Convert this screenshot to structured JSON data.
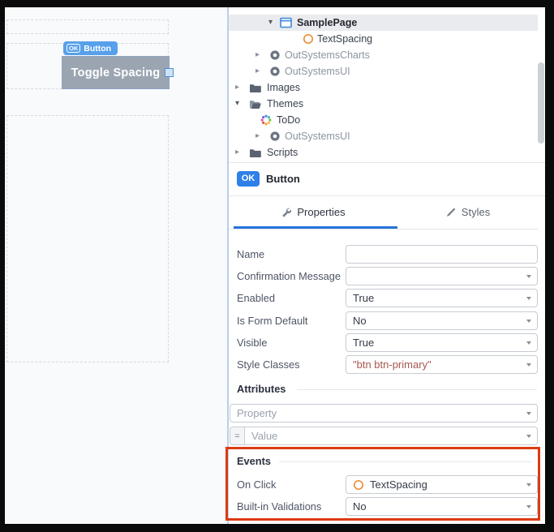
{
  "icons": {
    "chevron_down": "▾",
    "chevron_right": "▸"
  },
  "canvas": {
    "widget_badge": {
      "icon_label": "OK",
      "label": "Button"
    },
    "button_label": "Toggle Spacing"
  },
  "tree": {
    "items": [
      {
        "label": "SamplePage",
        "icon": "web-screen-icon",
        "state": "expanded",
        "selected": true
      },
      {
        "label": "TextSpacing",
        "icon": "screen-action-icon",
        "state": "leaf"
      },
      {
        "label": "OutSystemsCharts",
        "icon": "dependency-icon",
        "state": "collapsed",
        "muted": true
      },
      {
        "label": "OutSystemsUI",
        "icon": "dependency-icon",
        "state": "collapsed",
        "muted": true
      },
      {
        "label": "Images",
        "icon": "folder-icon",
        "state": "collapsed"
      },
      {
        "label": "Themes",
        "icon": "folder-open-icon",
        "state": "expanded"
      },
      {
        "label": "ToDo",
        "icon": "theme-icon",
        "state": "leaf"
      },
      {
        "label": "OutSystemsUI",
        "icon": "dependency-icon",
        "state": "collapsed",
        "muted": true
      },
      {
        "label": "Scripts",
        "icon": "folder-icon",
        "state": "collapsed"
      }
    ]
  },
  "inspector": {
    "header": {
      "badge": "OK",
      "title": "Button"
    },
    "tabs": [
      {
        "label": "Properties",
        "active": true
      },
      {
        "label": "Styles",
        "active": false
      }
    ],
    "fields": [
      {
        "label": "Name",
        "value": ""
      },
      {
        "label": "Confirmation Message",
        "value": ""
      },
      {
        "label": "Enabled",
        "value": "True"
      },
      {
        "label": "Is Form Default",
        "value": "No"
      },
      {
        "label": "Visible",
        "value": "True"
      },
      {
        "label": "Style Classes",
        "value": "\"btn btn-primary\""
      }
    ],
    "attributes": {
      "title": "Attributes",
      "property_placeholder": "Property",
      "equals_sign": "=",
      "value_placeholder": "Value"
    },
    "events": {
      "title": "Events",
      "on_click_label": "On Click",
      "on_click_value": "TextSpacing",
      "validations_label": "Built-in Validations",
      "validations_value": "No"
    }
  },
  "colors": {
    "accent_blue": "#2f7fe8",
    "tab_underline": "#2574db",
    "annotation_red": "#dc3a12",
    "expression_text": "#a85751",
    "selection_blue": "#4a90d9",
    "widget_gray": "#9ba5b2",
    "splitter_blue": "#bad0e8"
  }
}
